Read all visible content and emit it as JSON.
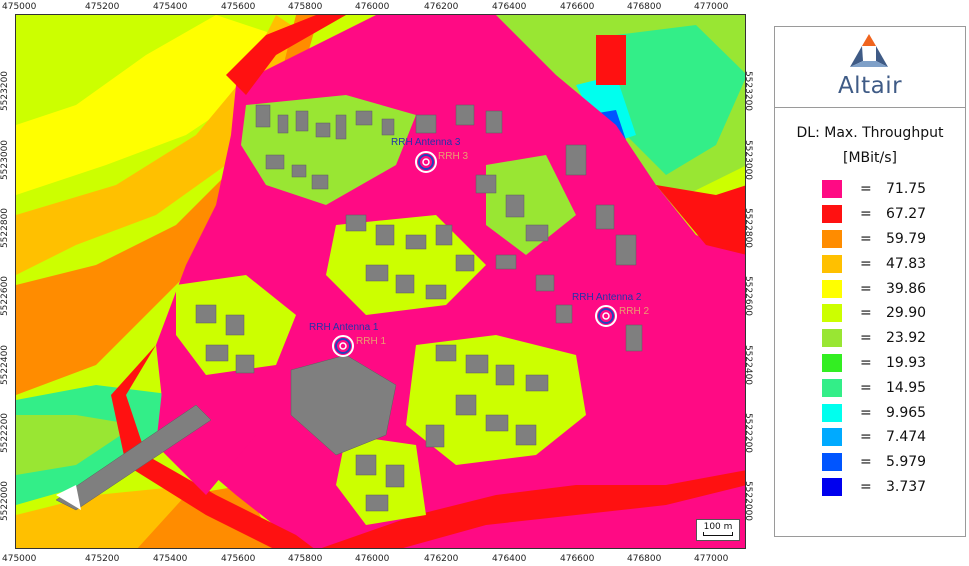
{
  "map": {
    "x_ticks": [
      "475000",
      "475200",
      "475400",
      "475600",
      "475800",
      "476000",
      "476200",
      "476400",
      "476600",
      "476800",
      "477000"
    ],
    "y_ticks_left": [
      "5523200",
      "5523000",
      "5522800",
      "5522600",
      "5522400",
      "5522200",
      "5522000"
    ],
    "y_ticks_right": [
      "5523200",
      "5523000",
      "5522800",
      "5522600",
      "5522400",
      "5522200",
      "5522000"
    ],
    "antennas": [
      {
        "name": "RRH Antenna 3",
        "tag": "RRH 3"
      },
      {
        "name": "RRH Antenna 1",
        "tag": "RRH 1"
      },
      {
        "name": "RRH Antenna 2",
        "tag": "RRH 2"
      }
    ],
    "scale_bar": "100 m",
    "colors": {
      "c71": "#ff0a84",
      "c67": "#ff1111",
      "c59": "#ff8c00",
      "c47": "#ffc000",
      "c39": "#ffff00",
      "c29": "#ccff00",
      "c23": "#99e633",
      "c19": "#33ee22",
      "c14": "#33ee88",
      "c9": "#00ffee",
      "c7": "#00aaff",
      "c5": "#0055ff",
      "c3": "#0000ee",
      "building": "#7f7f7f"
    }
  },
  "legend": {
    "logo_text": "Altair",
    "title_line1": "DL: Max. Throughput",
    "title_line2": "[MBit/s]",
    "entries": [
      {
        "color": "#ff0a84",
        "eq": "=",
        "value": "71.75"
      },
      {
        "color": "#ff1111",
        "eq": "=",
        "value": "67.27"
      },
      {
        "color": "#ff8c00",
        "eq": "=",
        "value": "59.79"
      },
      {
        "color": "#ffc000",
        "eq": "=",
        "value": "47.83"
      },
      {
        "color": "#ffff00",
        "eq": "=",
        "value": "39.86"
      },
      {
        "color": "#ccff00",
        "eq": "=",
        "value": "29.90"
      },
      {
        "color": "#99e633",
        "eq": "=",
        "value": "23.92"
      },
      {
        "color": "#33ee22",
        "eq": "=",
        "value": "19.93"
      },
      {
        "color": "#33ee88",
        "eq": "=",
        "value": "14.95"
      },
      {
        "color": "#00ffee",
        "eq": "=",
        "value": "9.965"
      },
      {
        "color": "#00aaff",
        "eq": "=",
        "value": "7.474"
      },
      {
        "color": "#0055ff",
        "eq": "=",
        "value": "5.979"
      },
      {
        "color": "#0000ee",
        "eq": "=",
        "value": "3.737"
      }
    ]
  }
}
